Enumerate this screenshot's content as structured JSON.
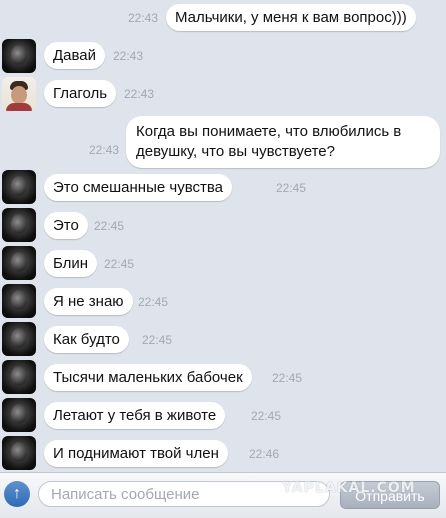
{
  "messages": [
    {
      "sender": "me",
      "text": "Мальчики, у меня к вам вопрос)))",
      "time": "22:43"
    },
    {
      "sender": "dark-avatar-user",
      "text": "Давай",
      "time": "22:43"
    },
    {
      "sender": "photo-avatar-user",
      "text": "Глаголь",
      "time": "22:43"
    },
    {
      "sender": "me",
      "text": "Когда вы понимаете, что влюбились в девушку, что вы чувствуете?",
      "time": "22:43"
    },
    {
      "sender": "dark-avatar-user",
      "text": "Это смешанные чувства",
      "time": "22:45"
    },
    {
      "sender": "dark-avatar-user",
      "text": "Это",
      "time": "22:45"
    },
    {
      "sender": "dark-avatar-user",
      "text": "Блин",
      "time": "22:45"
    },
    {
      "sender": "dark-avatar-user",
      "text": "Я не знаю",
      "time": "22:45"
    },
    {
      "sender": "dark-avatar-user",
      "text": "Как будто",
      "time": "22:45"
    },
    {
      "sender": "dark-avatar-user",
      "text": "Тысячи маленьких бабочек",
      "time": "22:45"
    },
    {
      "sender": "dark-avatar-user",
      "text": "Летают у тебя в животе",
      "time": "22:45"
    },
    {
      "sender": "dark-avatar-user",
      "text": "И поднимают твой член",
      "time": "22:46"
    }
  ],
  "composer": {
    "placeholder": "Написать сообщение",
    "send_label": "Отправить"
  },
  "watermark": "YAPLAKAL.COM",
  "colors": {
    "background": "#dfe4ec",
    "bubble": "#ffffff",
    "timestamp": "#a2a8b3",
    "upload_button": "#2f6bb5"
  }
}
